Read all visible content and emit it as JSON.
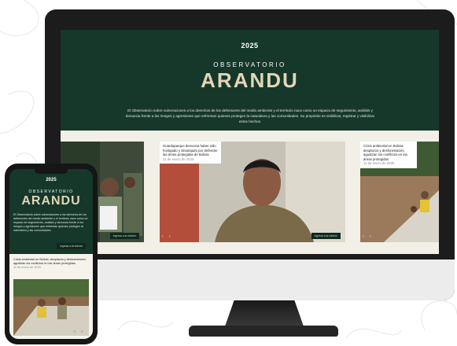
{
  "year": "2025",
  "observatory_label": "OBSERVATORIO",
  "brand_name": "ARANDU",
  "hero_description": "El Observatorio sobre vulneraciones a los derechos de los defensores del medio ambiente y el territorio nace como un espacio de seguimiento, análisis y denuncia frente a los riesgos y agresiones que enfrentan quienes protegen la naturaleza y las comunidades. Su propósito es visibilizar, registrar y visibilizar estos hechos.",
  "cards": [
    {
      "pill": "Ingresa a la edición"
    },
    {
      "title": "Guardaparque denuncia haber sido hostigado y desalojado por defender las áreas protegidas de Bolivia",
      "date": "11 de enero de 2025",
      "pill": "Ingresa a la edición"
    },
    {
      "title": "Crisis ambiental en Bolivia: desplazos y desforestación agudizan los conflictos en las áreas protegidas",
      "date": "11 de enero de 2025"
    }
  ],
  "phone": {
    "year": "2025",
    "observatory_label": "OBSERVATORIO",
    "brand_name": "ARANDU",
    "description": "El Observatorio sobre vulneraciones a los derechos de los defensores del medio ambiente y el territorio nace como un espacio de seguimiento, análisis y denuncia frente a los riesgos y agresiones que enfrentan quienes protegen la naturaleza y las comunidades.",
    "pill": "Ingresa a la edición",
    "card_title": "Crisis ambiental en Bolivia: desplazos y desforestación agudizan los conflictos en las áreas protegidas",
    "card_date": "11 de enero de 2025"
  },
  "colors": {
    "brand_green": "#15382b",
    "brand_gold": "#e3d6b6",
    "device_black": "#1c1c1c"
  }
}
